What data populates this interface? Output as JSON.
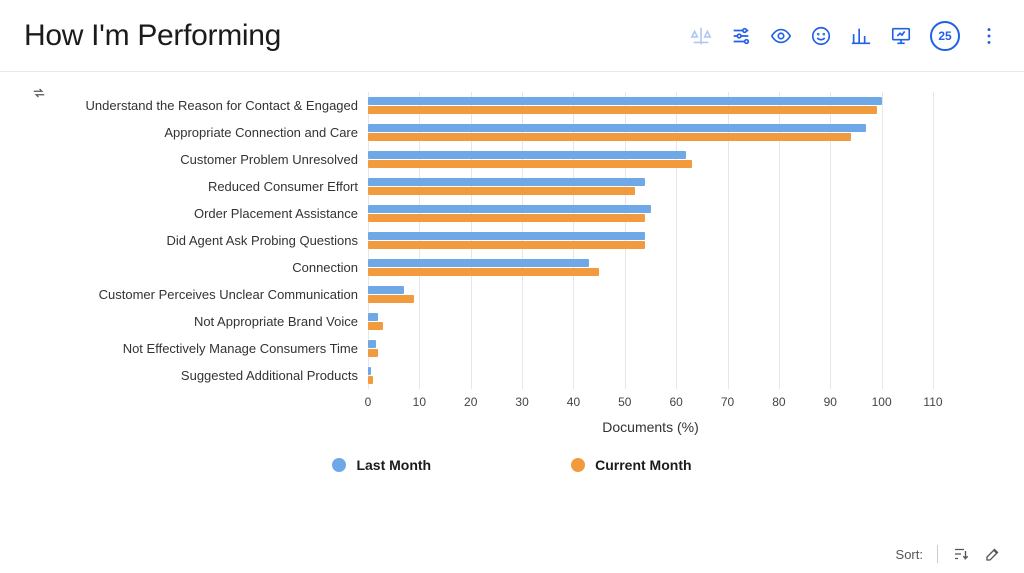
{
  "header": {
    "title": "How I'm Performing",
    "badge_value": "25"
  },
  "chart_data": {
    "type": "bar",
    "orientation": "horizontal",
    "xlabel": "Documents (%)",
    "xlim": [
      0,
      110
    ],
    "xticks": [
      0,
      10,
      20,
      30,
      40,
      50,
      60,
      70,
      80,
      90,
      100,
      110
    ],
    "categories": [
      "Understand the Reason for Contact & Engaged",
      "Appropriate Connection and Care",
      "Customer Problem Unresolved",
      "Reduced Consumer Effort",
      "Order Placement Assistance",
      "Did Agent Ask Probing Questions",
      "Connection",
      "Customer Perceives Unclear Communication",
      "Not Appropriate Brand Voice",
      "Not Effectively Manage Consumers Time",
      "Suggested Additional Products"
    ],
    "series": [
      {
        "name": "Last Month",
        "color": "#6fa8e6",
        "values": [
          100,
          97,
          62,
          54,
          55,
          54,
          43,
          7,
          2,
          1.5,
          0.5
        ]
      },
      {
        "name": "Current Month",
        "color": "#f19a3e",
        "values": [
          99,
          94,
          63,
          52,
          54,
          54,
          45,
          9,
          3,
          2,
          1
        ]
      }
    ],
    "legend_position": "bottom",
    "grid": true
  },
  "footer": {
    "sort_label": "Sort:"
  }
}
